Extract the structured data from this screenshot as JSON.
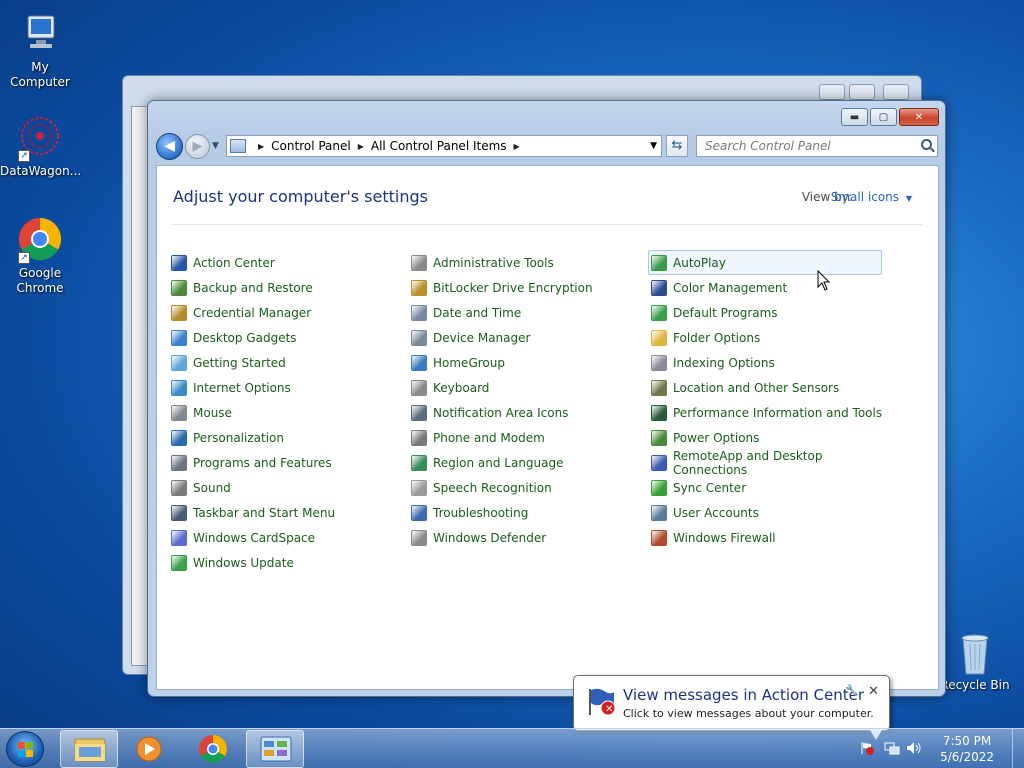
{
  "desktop": {
    "icons": [
      {
        "label": "My Computer"
      },
      {
        "label": "DataWagon..."
      },
      {
        "label": "Google Chrome"
      },
      {
        "label": "Recycle Bin"
      }
    ]
  },
  "window": {
    "address": {
      "crumbs": [
        "Control Panel",
        "All Control Panel Items"
      ]
    },
    "search_placeholder": "Search Control Panel",
    "heading": "Adjust your computer's settings",
    "view_by_label": "View by:",
    "view_by_value": "Small icons",
    "columns": [
      [
        {
          "label": "Action Center",
          "icon": "flag-icon",
          "color": "#2456a8"
        },
        {
          "label": "Backup and Restore",
          "icon": "backup-icon",
          "color": "#4d8a3a"
        },
        {
          "label": "Credential Manager",
          "icon": "vault-icon",
          "color": "#b58a2a"
        },
        {
          "label": "Desktop Gadgets",
          "icon": "gadgets-icon",
          "color": "#3a7fd0"
        },
        {
          "label": "Getting Started",
          "icon": "getting-started-icon",
          "color": "#62a6d8"
        },
        {
          "label": "Internet Options",
          "icon": "globe-icon",
          "color": "#3a8ac8"
        },
        {
          "label": "Mouse",
          "icon": "mouse-icon",
          "color": "#808890"
        },
        {
          "label": "Personalization",
          "icon": "monitor-icon",
          "color": "#2a6ab0"
        },
        {
          "label": "Programs and Features",
          "icon": "programs-icon",
          "color": "#6a7480"
        },
        {
          "label": "Sound",
          "icon": "speaker-icon",
          "color": "#7a7a7a"
        },
        {
          "label": "Taskbar and Start Menu",
          "icon": "taskbar-icon",
          "color": "#4a5a70"
        },
        {
          "label": "Windows CardSpace",
          "icon": "cardspace-icon",
          "color": "#5a6ad0"
        },
        {
          "label": "Windows Update",
          "icon": "update-icon",
          "color": "#3aa04a"
        }
      ],
      [
        {
          "label": "Administrative Tools",
          "icon": "admin-tools-icon",
          "color": "#8a8a8a"
        },
        {
          "label": "BitLocker Drive Encryption",
          "icon": "bitlocker-icon",
          "color": "#b8902a"
        },
        {
          "label": "Date and Time",
          "icon": "clock-icon",
          "color": "#7a8aa0"
        },
        {
          "label": "Device Manager",
          "icon": "device-manager-icon",
          "color": "#7a8a9a"
        },
        {
          "label": "HomeGroup",
          "icon": "homegroup-icon",
          "color": "#3a7ac0"
        },
        {
          "label": "Keyboard",
          "icon": "keyboard-icon",
          "color": "#8a8a8a"
        },
        {
          "label": "Notification Area Icons",
          "icon": "notification-icon",
          "color": "#5a6a80"
        },
        {
          "label": "Phone and Modem",
          "icon": "phone-icon",
          "color": "#7a7a7a"
        },
        {
          "label": "Region and Language",
          "icon": "region-icon",
          "color": "#3a8a5a"
        },
        {
          "label": "Speech Recognition",
          "icon": "microphone-icon",
          "color": "#9a9a9a"
        },
        {
          "label": "Troubleshooting",
          "icon": "troubleshoot-icon",
          "color": "#3a6ab0"
        },
        {
          "label": "Windows Defender",
          "icon": "defender-icon",
          "color": "#8a8a8a"
        }
      ],
      [
        {
          "label": "AutoPlay",
          "icon": "autoplay-icon",
          "color": "#3a9a4a"
        },
        {
          "label": "Color Management",
          "icon": "color-mgmt-icon",
          "color": "#2a4a90"
        },
        {
          "label": "Default Programs",
          "icon": "default-programs-icon",
          "color": "#3aa04a"
        },
        {
          "label": "Folder Options",
          "icon": "folder-icon",
          "color": "#e0b640"
        },
        {
          "label": "Indexing Options",
          "icon": "indexing-icon",
          "color": "#8a8a9a"
        },
        {
          "label": "Location and Other Sensors",
          "icon": "sensor-icon",
          "color": "#6a7a4a"
        },
        {
          "label": "Performance Information and Tools",
          "icon": "performance-icon",
          "color": "#2a5a3a"
        },
        {
          "label": "Power Options",
          "icon": "power-icon",
          "color": "#4a8a3a"
        },
        {
          "label": "RemoteApp and Desktop Connections",
          "icon": "remoteapp-icon",
          "color": "#3a5ab0"
        },
        {
          "label": "Sync Center",
          "icon": "sync-icon",
          "color": "#3aa03a"
        },
        {
          "label": "User Accounts",
          "icon": "users-icon",
          "color": "#5a7a9a"
        },
        {
          "label": "Windows Firewall",
          "icon": "firewall-icon",
          "color": "#b04a2a"
        }
      ]
    ]
  },
  "notification": {
    "title": "View messages in Action Center",
    "body": "Click to view messages about your computer."
  },
  "taskbar": {
    "time": "7:50 PM",
    "date": "5/6/2022"
  }
}
